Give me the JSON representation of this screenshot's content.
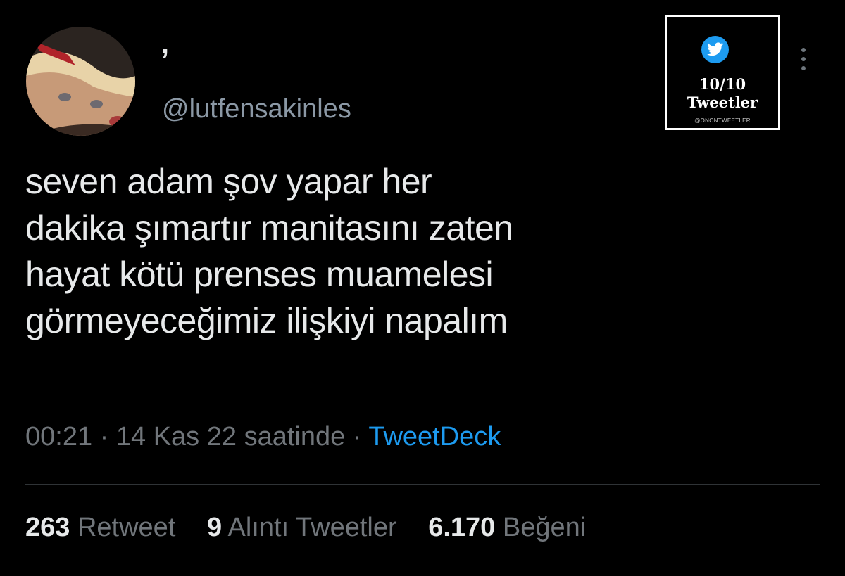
{
  "author": {
    "display_name": "’",
    "handle": "@lutfensakinles"
  },
  "badge": {
    "number": "10/10",
    "title": "Tweetler",
    "credit": "@ONONTWEETLER",
    "bird_icon": "twitter-bird-icon",
    "bird_color": "#1d9bf0"
  },
  "tweet": {
    "text": "seven adam şov yapar her\ndakika şımartır manitasını zaten\nhayat kötü prenses muamelesi\ngörmeyeceğimiz ilişkiyi napalım",
    "time": "00:21",
    "date": "14 Kas 22 saatinde",
    "separator": "·",
    "source": "TweetDeck"
  },
  "stats": [
    {
      "count": "263",
      "label": "Retweet"
    },
    {
      "count": "9",
      "label": "Alıntı Tweetler"
    },
    {
      "count": "6.170",
      "label": "Beğeni"
    }
  ],
  "colors": {
    "background": "#000000",
    "text": "#e7e9ea",
    "muted": "#71767b",
    "link": "#1d9bf0"
  }
}
